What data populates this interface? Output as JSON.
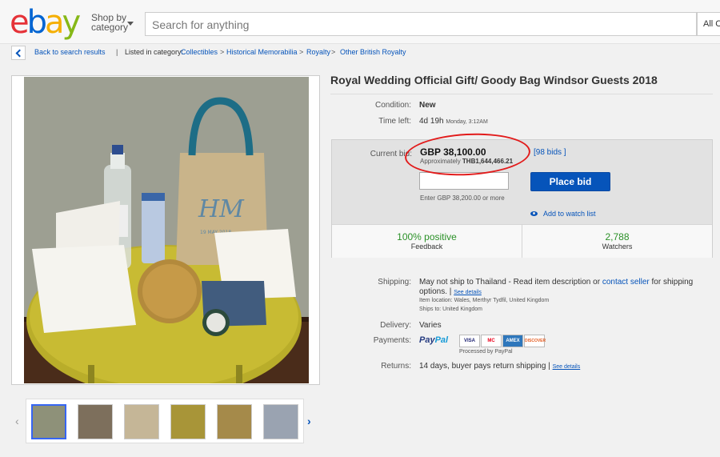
{
  "header": {
    "logo": [
      "e",
      "b",
      "a",
      "y"
    ],
    "shop_by": "Shop by",
    "category": "category",
    "search_placeholder": "Search for anything",
    "category_select": "All C"
  },
  "breadcrumb": {
    "back": "Back to search results",
    "listed_in": "Listed in category:",
    "items": [
      "Collectibles",
      "Historical Memorabilia",
      "Royalty",
      "Other British Royalty"
    ]
  },
  "listing": {
    "title": "Royal Wedding Official Gift/ Goody Bag Windsor Guests 2018",
    "condition_label": "Condition:",
    "condition": "New",
    "time_left_label": "Time left:",
    "time_left": "4d 19h",
    "time_left_day": "Monday, 3:12AM",
    "current_bid_label": "Current bid:",
    "current_bid": "GBP 38,100.00",
    "approx_label": "Approximately",
    "approx_value": "THB1,644,466.21",
    "bids": "98 bids",
    "enter_bid_hint": "Enter GBP 38,200.00 or more",
    "place_bid": "Place bid",
    "add_to_watch": "Add to watch list",
    "feedback_value": "100% positive",
    "feedback_label": "Feedback",
    "watchers_value": "2,788",
    "watchers_label": "Watchers",
    "shipping_label": "Shipping:",
    "shipping_text": "May not ship to Thailand - Read item description or",
    "contact_seller": "contact seller",
    "shipping_text2": "for shipping",
    "shipping_text3": "options.",
    "see_details": "See details",
    "item_location": "Item location:  Wales, Merthyr Tydfil, United Kingdom",
    "ships_to": "Ships to:  United Kingdom",
    "delivery_label": "Delivery:",
    "delivery": "Varies",
    "payments_label": "Payments:",
    "paypal_a": "Pay",
    "paypal_b": "Pal",
    "processed_by": "Processed by PayPal",
    "cards": [
      "VISA",
      "MC",
      "AMEX",
      "DISCOVER"
    ],
    "returns_label": "Returns:",
    "returns_text": "14 days, buyer pays return shipping",
    "returns_see_details": "See details"
  },
  "colors": {
    "accent": "#0654ba",
    "positive": "#2b9128",
    "highlight_ring": "#e21b1b"
  }
}
